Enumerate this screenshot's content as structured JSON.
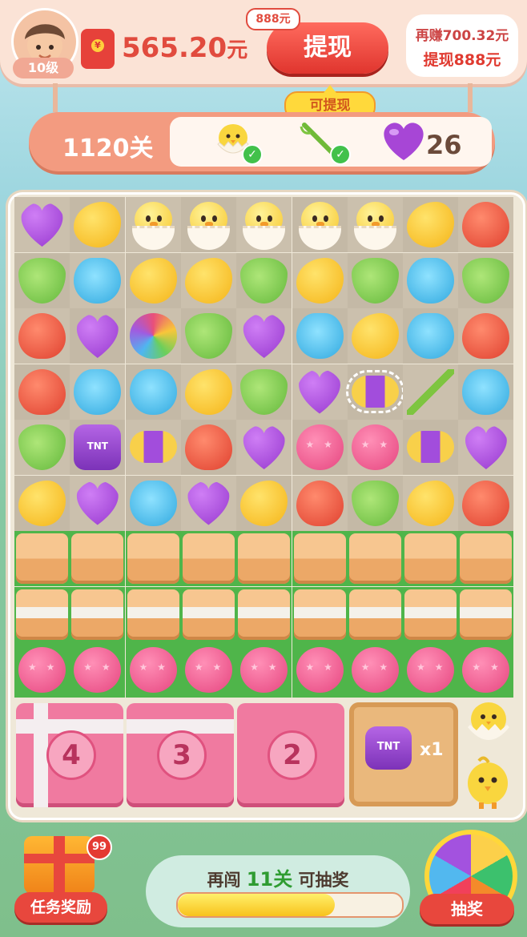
{
  "player": {
    "level_label": "10级"
  },
  "wallet": {
    "balance": "565.20",
    "unit": "元"
  },
  "withdraw": {
    "button_label": "提现",
    "tag": "888元",
    "available_label": "可提现"
  },
  "bubble": {
    "line1": "再赚700.32元",
    "line2": "提现888元"
  },
  "level": {
    "label": "1120关"
  },
  "goals": [
    {
      "icon": "chick-icon",
      "done": true
    },
    {
      "icon": "bamboo-icon",
      "done": true
    },
    {
      "icon": "heart-icon",
      "count": "26"
    }
  ],
  "board": {
    "rows": [
      [
        "heart",
        "drop",
        "chick",
        "chick",
        "chick",
        "chick",
        "chick",
        "drop",
        "apple"
      ],
      [
        "pear",
        "shell",
        "drop",
        "drop",
        "pear",
        "drop",
        "pear",
        "shell",
        "pear"
      ],
      [
        "apple",
        "heart",
        "rainbow",
        "pear",
        "heart",
        "shell",
        "drop",
        "shell",
        "apple"
      ],
      [
        "apple",
        "shell",
        "shell",
        "drop",
        "pear",
        "heart",
        "rocket",
        "bamboo",
        "shell"
      ],
      [
        "pear",
        "tnt",
        "rocket",
        "apple",
        "heart",
        "balloon",
        "balloon",
        "rocket",
        "heart"
      ],
      [
        "drop",
        "heart",
        "shell",
        "heart",
        "drop",
        "apple",
        "pear",
        "drop",
        "apple"
      ],
      [
        "crate",
        "crate",
        "crate",
        "crate",
        "crate",
        "crate",
        "crate",
        "crate",
        "crate"
      ],
      [
        "crate-tape",
        "crate-tape",
        "crate-tape",
        "crate-tape",
        "crate-tape",
        "crate-tape",
        "crate-tape",
        "crate-tape",
        "crate-tape"
      ],
      [
        "balloon",
        "balloon",
        "balloon",
        "balloon",
        "balloon",
        "balloon",
        "balloon",
        "balloon",
        "balloon"
      ]
    ],
    "big_boxes": [
      {
        "number": "4"
      },
      {
        "number": "3"
      },
      {
        "number": "2"
      }
    ],
    "tnt_slot": {
      "count": "x1",
      "label": "TNT"
    },
    "tnt_label": "TNT"
  },
  "bottom": {
    "task_label": "任务奖励",
    "task_badge": "99",
    "progress_prefix": "再闯",
    "progress_levels": "11关",
    "progress_suffix": "可抽奖",
    "progress_value": 0.7,
    "lottery_label": "抽奖"
  }
}
